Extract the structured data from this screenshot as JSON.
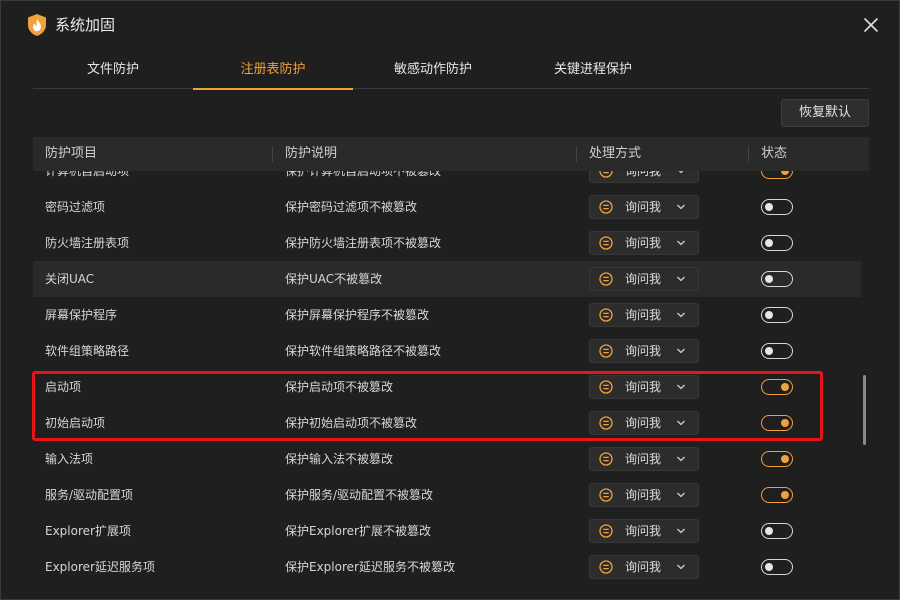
{
  "window": {
    "title": "系统加固"
  },
  "tabs": [
    {
      "label": "文件防护"
    },
    {
      "label": "注册表防护"
    },
    {
      "label": "敏感动作防护"
    },
    {
      "label": "关键进程保护"
    }
  ],
  "active_tab": "注册表防护",
  "toolbar": {
    "restore_label": "恢复默认"
  },
  "table": {
    "columns": [
      "防护项目",
      "防护说明",
      "处理方式",
      "状态"
    ],
    "rows": [
      {
        "name": "计算机自启动项",
        "desc": "保护计算机自启动项不被篡改",
        "action": "询问我",
        "enabled": true
      },
      {
        "name": "密码过滤项",
        "desc": "保护密码过滤项不被篡改",
        "action": "询问我",
        "enabled": false
      },
      {
        "name": "防火墙注册表项",
        "desc": "保护防火墙注册表项不被篡改",
        "action": "询问我",
        "enabled": false
      },
      {
        "name": "关闭UAC",
        "desc": "保护UAC不被篡改",
        "action": "询问我",
        "enabled": false
      },
      {
        "name": "屏幕保护程序",
        "desc": "保护屏幕保护程序不被篡改",
        "action": "询问我",
        "enabled": false
      },
      {
        "name": "软件组策略路径",
        "desc": "保护软件组策略路径不被篡改",
        "action": "询问我",
        "enabled": false
      },
      {
        "name": "启动项",
        "desc": "保护启动项不被篡改",
        "action": "询问我",
        "enabled": true
      },
      {
        "name": "初始启动项",
        "desc": "保护初始启动项不被篡改",
        "action": "询问我",
        "enabled": true
      },
      {
        "name": "输入法项",
        "desc": "保护输入法不被篡改",
        "action": "询问我",
        "enabled": true
      },
      {
        "name": "服务/驱动配置项",
        "desc": "保护服务/驱动配置不被篡改",
        "action": "询问我",
        "enabled": true
      },
      {
        "name": "Explorer扩展项",
        "desc": "保护Explorer扩展不被篡改",
        "action": "询问我",
        "enabled": false
      },
      {
        "name": "Explorer延迟服务项",
        "desc": "保护Explorer延迟服务不被篡改",
        "action": "询问我",
        "enabled": false
      }
    ]
  },
  "colors": {
    "accent": "#f0a13a",
    "highlight": "#e8141a",
    "background": "#1f1f1f"
  },
  "icons": {
    "logo": "shield-flame-icon",
    "close": "close-icon",
    "ask": "ask-icon",
    "dropdown": "chevron-down-icon"
  }
}
